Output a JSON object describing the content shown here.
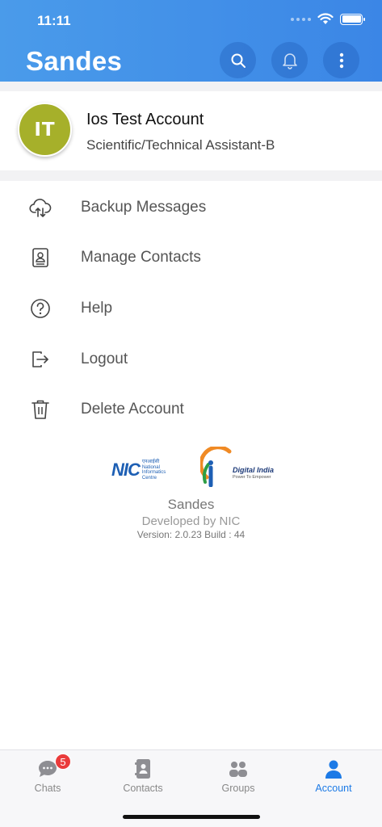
{
  "status_bar": {
    "time": "11:11"
  },
  "header": {
    "title": "Sandes",
    "icons": [
      "search-icon",
      "bell-icon",
      "more-vertical-icon"
    ],
    "color": "#3d8ae6"
  },
  "profile": {
    "initials": "IT",
    "name": "Ios Test Account",
    "role": "Scientific/Technical Assistant-B",
    "avatar_color": "#a6b02a"
  },
  "menu": {
    "items": [
      {
        "label": "Backup Messages",
        "icon": "cloud-sync-icon"
      },
      {
        "label": "Manage Contacts",
        "icon": "contact-book-icon"
      },
      {
        "label": "Help",
        "icon": "help-circle-icon"
      },
      {
        "label": "Logout",
        "icon": "logout-icon"
      },
      {
        "label": "Delete Account",
        "icon": "trash-icon"
      }
    ]
  },
  "footer": {
    "nic_logo": {
      "short": "NIC",
      "lines": [
        "एनआईसी",
        "National",
        "Informatics",
        "Centre"
      ]
    },
    "digital_india_logo": {
      "title": "Digital India",
      "tagline": "Power To Empower"
    },
    "app_name": "Sandes",
    "developer": "Developed by NIC",
    "version": "Version: 2.0.23 Build : 44"
  },
  "tabbar": {
    "tabs": [
      {
        "label": "Chats",
        "icon": "chat-bubble-icon",
        "badge": "5",
        "active": false
      },
      {
        "label": "Contacts",
        "icon": "contacts-icon",
        "active": false
      },
      {
        "label": "Groups",
        "icon": "groups-icon",
        "active": false
      },
      {
        "label": "Account",
        "icon": "person-icon",
        "active": true
      }
    ],
    "active_color": "#1c7ae6",
    "inactive_color": "#8e8e93"
  }
}
